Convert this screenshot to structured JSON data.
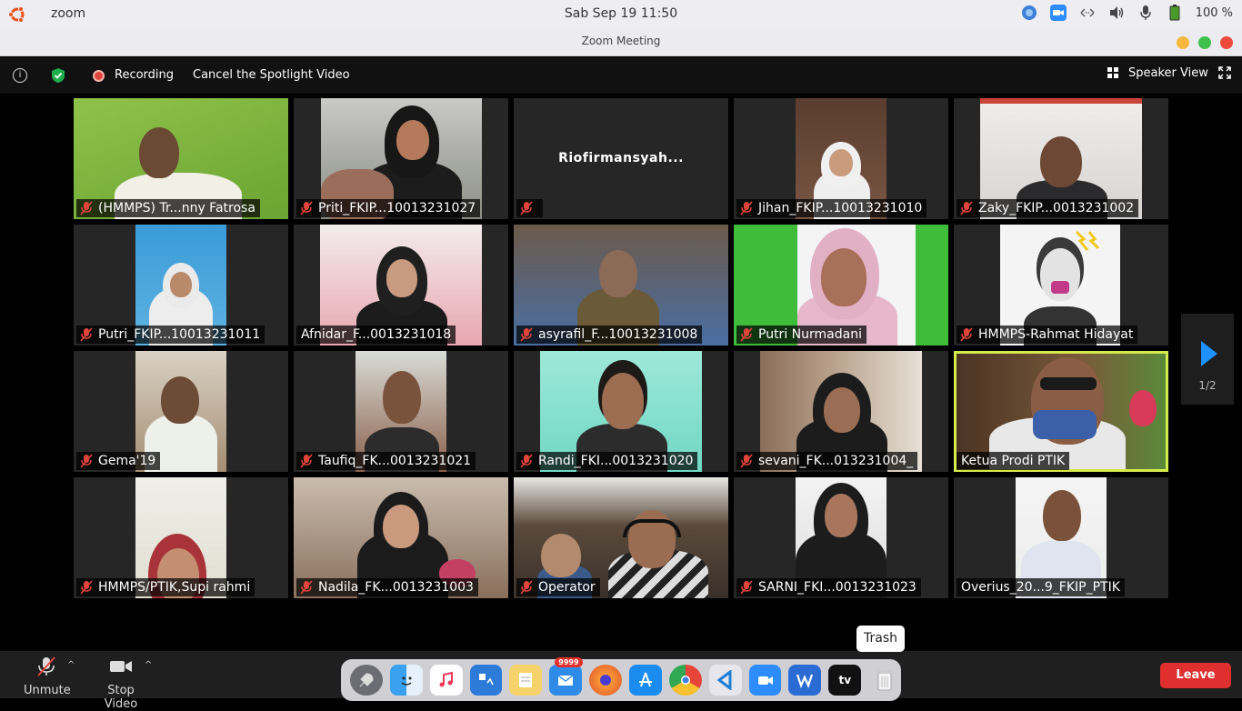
{
  "system_bar": {
    "app_name": "zoom",
    "clock": "Sab Sep 19  11:50",
    "battery_percent": "100 %",
    "icons": [
      "ubuntu-logo-icon",
      "colorpicker-icon",
      "zoom-tray-icon",
      "network-icon",
      "volume-icon",
      "microphone-icon",
      "battery-icon"
    ]
  },
  "window": {
    "title": "Zoom Meeting",
    "controls": [
      "minimize",
      "maximize",
      "close"
    ],
    "control_colors": {
      "minimize": "#f6b73c",
      "maximize": "#3ec04b",
      "close": "#ee4a3b"
    }
  },
  "meeting_toolbar": {
    "recording_label": "Recording",
    "spotlight_label": "Cancel the Spotlight Video",
    "view_label": "Speaker View"
  },
  "participants": [
    {
      "name": "(HMMPS) Tr...nny Fatrosa",
      "muted": true
    },
    {
      "name": "Priti_FKIP...10013231027",
      "muted": true
    },
    {
      "name": "",
      "muted": true,
      "video_off_name": "Riofirmansyah..."
    },
    {
      "name": "Jihan_FKIP...10013231010",
      "muted": true
    },
    {
      "name": "Zaky_FKIP...0013231002",
      "muted": true
    },
    {
      "name": "Putri_FKIP...10013231011",
      "muted": true
    },
    {
      "name": "Afnidar_F...0013231018",
      "muted": false
    },
    {
      "name": "asyrafil_F...10013231008",
      "muted": true
    },
    {
      "name": "Putri Nurmadani",
      "muted": true
    },
    {
      "name": "HMMPS-Rahmat Hidayat",
      "muted": true
    },
    {
      "name": "Gema'19",
      "muted": true
    },
    {
      "name": "Taufiq_FK...0013231021",
      "muted": true
    },
    {
      "name": "Randi_FKI...0013231020",
      "muted": true
    },
    {
      "name": "sevani_FK...013231004_",
      "muted": true
    },
    {
      "name": "Ketua Prodi PTIK",
      "muted": false,
      "active_speaker": true
    },
    {
      "name": "HMMPS/PTIK,Supi rahmi",
      "muted": true
    },
    {
      "name": "Nadila_FK...0013231003",
      "muted": true
    },
    {
      "name": "Operator",
      "muted": true
    },
    {
      "name": "SARNI_FKI...0013231023",
      "muted": true
    },
    {
      "name": "Overius_20...9_FKIP_PTIK",
      "muted": false
    }
  ],
  "pager": {
    "label": "1/2"
  },
  "bottom_bar": {
    "unmute_label": "Unmute",
    "stop_video_label": "Stop Video",
    "leave_label": "Leave"
  },
  "dock": {
    "tooltip": "Trash",
    "badge": "9999",
    "apps": [
      "rocket-icon",
      "finder-icon",
      "music-icon",
      "system-pref-icon",
      "notes-icon",
      "mail-icon",
      "firefox-icon",
      "appstore-icon",
      "chrome-icon",
      "vscode-icon",
      "zoom-icon",
      "wps-icon",
      "appletv-icon",
      "trash-icon"
    ],
    "tv_label": "tv"
  },
  "colors": {
    "active_speaker_border": "#d7ea4b",
    "leave_button": "#e02f2f",
    "mute_icon": "#e0453b",
    "pager_arrow": "#1e90ff"
  }
}
